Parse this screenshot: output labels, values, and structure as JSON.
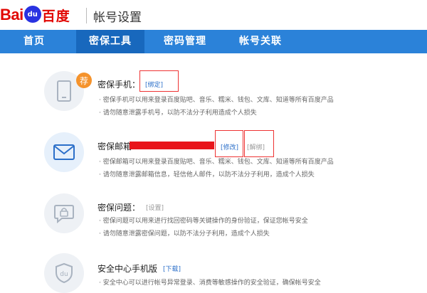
{
  "header": {
    "logo_text": "Bai",
    "logo_paw": "du",
    "logo_cn": "百度",
    "title": "帐号设置"
  },
  "nav": {
    "tabs": [
      {
        "label": "首页",
        "active": false
      },
      {
        "label": "密保工具",
        "active": true
      },
      {
        "label": "密码管理",
        "active": false
      },
      {
        "label": "帐号关联",
        "active": false
      }
    ]
  },
  "badge": "荐",
  "sections": [
    {
      "icon": "phone-icon",
      "title": "密保手机：",
      "actions": [
        "[绑定]"
      ],
      "desc": [
        "· 密保手机可以用来登录百度贴吧、音乐、糯米、钱包、文库、知道等所有百度产品",
        "· 请勿随意泄露手机号，以防不法分子利用造成个人损失"
      ]
    },
    {
      "icon": "mail-icon",
      "title": "密保邮箱",
      "actions": [
        "[修改]",
        "[解绑]"
      ],
      "desc": [
        "· 密保邮箱可以用来登录百度贴吧、音乐、糯米、钱包、文库、知道等所有百度产品",
        "· 请勿随意泄露邮箱信息，轻信他人邮件，以防不法分子利用，造成个人损失"
      ]
    },
    {
      "icon": "lock-chat-icon",
      "title": "密保问题：",
      "actions": [
        "[设置]"
      ],
      "desc": [
        "· 密保问题可以用来进行找回密码等关键操作的身份验证，保证您帐号安全",
        "· 请勿随意泄露密保问题，以防不法分子利用，造成个人损失"
      ]
    },
    {
      "icon": "shield-du-icon",
      "title": "安全中心手机版",
      "actions": [
        "[下载]"
      ],
      "desc": [
        "· 安全中心可以进行帐号异常登录、消费等敏感操作的安全验证，确保帐号安全"
      ]
    }
  ],
  "colors": {
    "brand_red": "#e10602",
    "brand_blue": "#2932e1",
    "nav_bg": "#2b82d9",
    "nav_active": "#1868bd",
    "link": "#2b6fc9",
    "badge": "#f5932c",
    "highlight_box": "#ee3333"
  }
}
